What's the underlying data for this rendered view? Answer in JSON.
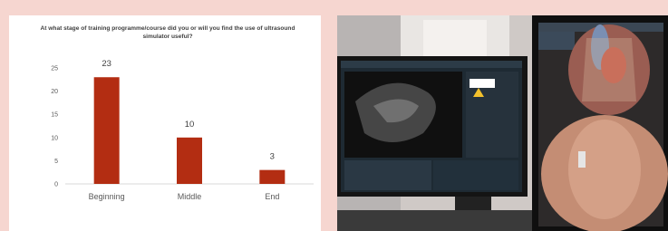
{
  "chart_data": {
    "type": "bar",
    "title": "At what stage of training programme/course did you or will you find the use of ultrasound simulator useful?",
    "categories": [
      "Beginning",
      "Middle",
      "End"
    ],
    "values": [
      23,
      10,
      3
    ],
    "ylim": [
      0,
      25
    ],
    "yticks": [
      0,
      5,
      10,
      15,
      20,
      25
    ],
    "grid": false,
    "legend": "none",
    "bar_color": "#b32d12"
  },
  "photo": {
    "description_icon": "ultrasound-simulator-monitors-photo"
  }
}
